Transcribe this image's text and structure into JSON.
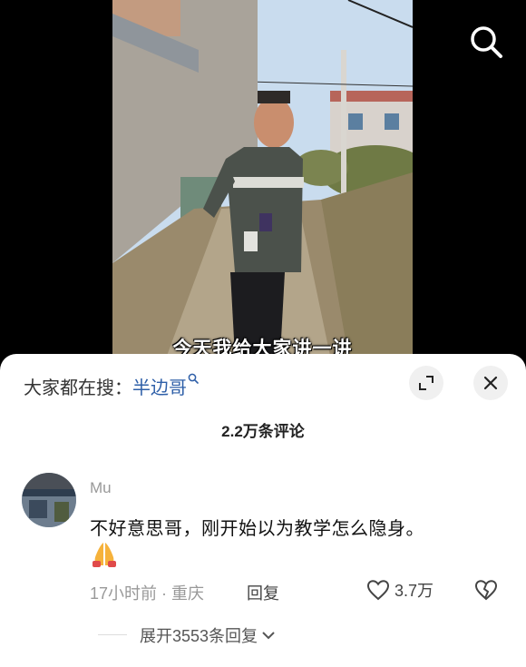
{
  "video": {
    "subtitle": "今天我给大家讲一讲",
    "icons": {
      "search": "search-icon"
    }
  },
  "sheet": {
    "search_prefix": "大家都在搜：",
    "search_keyword": "半边哥",
    "comment_count": "2.2万条评论",
    "icons": {
      "expand": "expand-icon",
      "close": "close-icon",
      "keyword_search": "search-icon"
    }
  },
  "comment": {
    "username": "Mu",
    "text": "不好意思哥，刚开始以为教学怎么隐身。",
    "emoji": "pray-emoji",
    "time_location": "17小时前 · 重庆",
    "reply_label": "回复",
    "like_count": "3.7万",
    "icons": {
      "like": "heart-outline-icon",
      "dislike": "broken-heart-icon"
    }
  },
  "replies": {
    "expand_label": "展开3553条回复",
    "icon": "chevron-down-icon"
  }
}
